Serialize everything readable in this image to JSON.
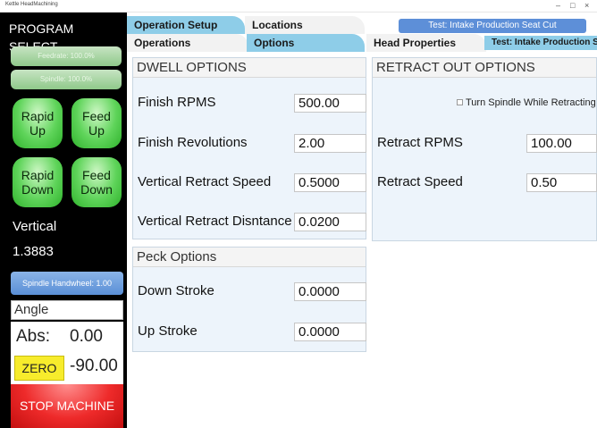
{
  "window": {
    "title": "Kettle HeadMachining",
    "controls": [
      "–",
      "□",
      "×"
    ]
  },
  "left": {
    "program_select": "PROGRAM SELECT",
    "feedrate": "Feedrate: 100.0%",
    "spindle": "Spindle: 100.0%",
    "rapid_up": "Rapid\nUp",
    "feed_up": "Feed\nUp",
    "rapid_down": "Rapid\nDown",
    "feed_down": "Feed\nDown",
    "axis_label": "Vertical",
    "axis_value": "1.3883",
    "handwheel": "Spindle Handwheel: 1.00",
    "angle_label": "Angle",
    "abs_label": "Abs:",
    "abs_value": "0.00",
    "zero_label": "ZERO",
    "zero_value": "-90.00",
    "stop": "STOP MACHINE"
  },
  "tabs": {
    "operation_setup": "Operation Setup",
    "locations": "Locations",
    "program_top": "Test: Intake Production Seat Cut",
    "operations": "Operations",
    "options": "Options",
    "head_properties": "Head Properties",
    "program_bottom": "Test: Intake Production Seat Cut"
  },
  "dwell": {
    "title": "DWELL OPTIONS",
    "rows": [
      {
        "label": "Finish RPMS",
        "value": "500.00"
      },
      {
        "label": "Finish Revolutions",
        "value": "2.00"
      },
      {
        "label": "Vertical Retract Speed",
        "value": "0.5000"
      },
      {
        "label": "Vertical Retract Disntance",
        "value": "0.0200"
      }
    ]
  },
  "peck": {
    "title": "Peck Options",
    "rows": [
      {
        "label": "Down Stroke",
        "value": "0.0000"
      },
      {
        "label": "Up Stroke",
        "value": "0.0000"
      }
    ]
  },
  "retract": {
    "title": "RETRACT OUT OPTIONS",
    "checkbox_label": "Turn Spindle While Retracting",
    "checkbox_checked": false,
    "rows": [
      {
        "label": "Retract RPMS",
        "value": "100.00"
      },
      {
        "label": "Retract Speed",
        "value": "0.50"
      }
    ]
  },
  "colors": {
    "left_bg": "#000000",
    "tab_blue": "#8ecde8",
    "program_blue": "#5d8fd8",
    "group_bg": "#edf4fb",
    "jog_green": "#5fd45a",
    "stop_red": "#ee2a2a",
    "zero_yellow": "#f7ec2c"
  }
}
